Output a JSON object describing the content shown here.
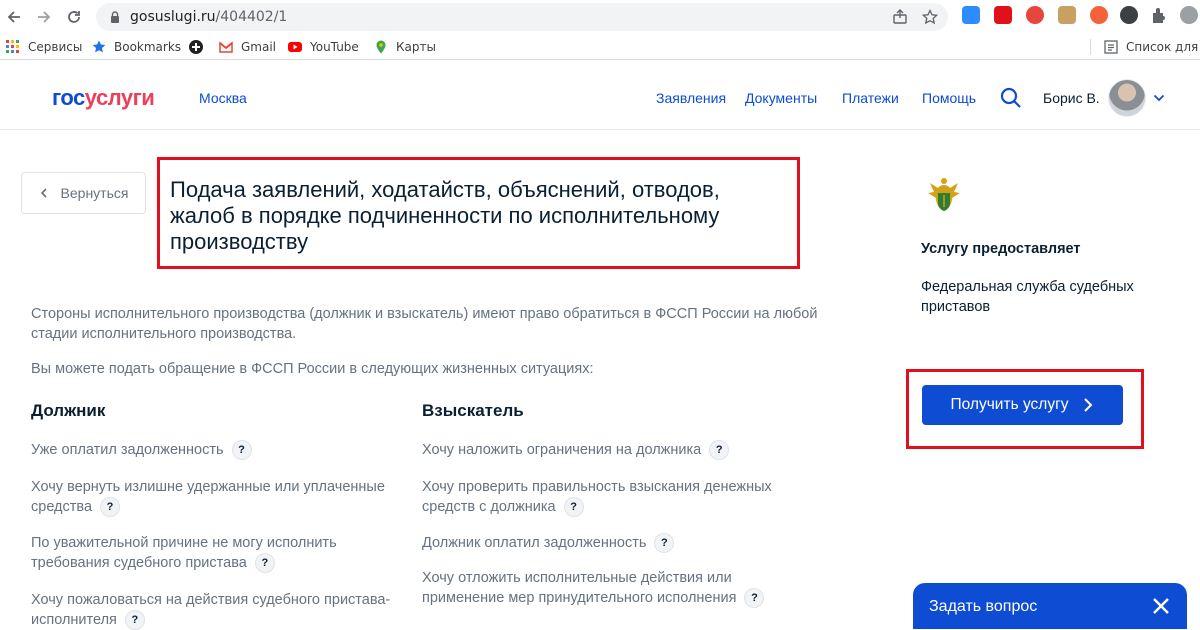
{
  "browser": {
    "url_host": "gosuslugi.ru",
    "url_path": "/404402/1",
    "bookmarks": [
      {
        "label": "Сервисы",
        "icon": "apps-grid-icon"
      },
      {
        "label": "Bookmarks",
        "icon": "star-icon"
      },
      {
        "label": "",
        "icon": "circle-plus-icon"
      },
      {
        "label": "Gmail",
        "icon": "gmail-icon"
      },
      {
        "label": "YouTube",
        "icon": "youtube-icon"
      },
      {
        "label": "Карты",
        "icon": "maps-pin-icon"
      }
    ],
    "reading_list": "Список для чт"
  },
  "header": {
    "logo_part1": "гос",
    "logo_part2": "услуги",
    "city": "Москва",
    "nav": [
      "Заявления",
      "Документы",
      "Платежи",
      "Помощь"
    ],
    "user_name": "Борис В."
  },
  "main": {
    "back_label": "Вернуться",
    "title": "Подача заявлений, ходатайств, объяснений, отводов, жалоб в порядке подчиненности по исполнительному производству",
    "intro_1": "Стороны исполнительного производства (должник и взыскатель) имеют право обратиться в ФССП России на любой стадии исполнительного производства.",
    "intro_2": "Вы можете подать обращение в ФССП России в следующих жизненных ситуациях:",
    "debtor": {
      "heading": "Должник",
      "items": [
        "Уже оплатил задолженность",
        "Хочу вернуть излишне удержанные или уплаченные средства",
        "По уважительной причине не могу исполнить требования судебного пристава",
        "Хочу пожаловаться на действия судебного пристава-исполнителя"
      ]
    },
    "creditor": {
      "heading": "Взыскатель",
      "items": [
        "Хочу наложить ограничения на должника",
        "Хочу проверить правильность взыскания денежных средств с должника",
        "Должник оплатил задолженность",
        "Хочу отложить исполнительные действия или применение мер принудительного исполнения"
      ]
    },
    "help_mark": "?"
  },
  "aside": {
    "provider_label": "Услугу предоставляет",
    "provider_name": "Федеральная служба судебных приставов",
    "cta_label": "Получить услугу"
  },
  "chat": {
    "label": "Задать вопрос"
  },
  "colors": {
    "brand_blue": "#0d4cd3",
    "brand_red": "#ee3f58",
    "highlight_red": "#e0111b",
    "muted_text": "#66727f"
  }
}
